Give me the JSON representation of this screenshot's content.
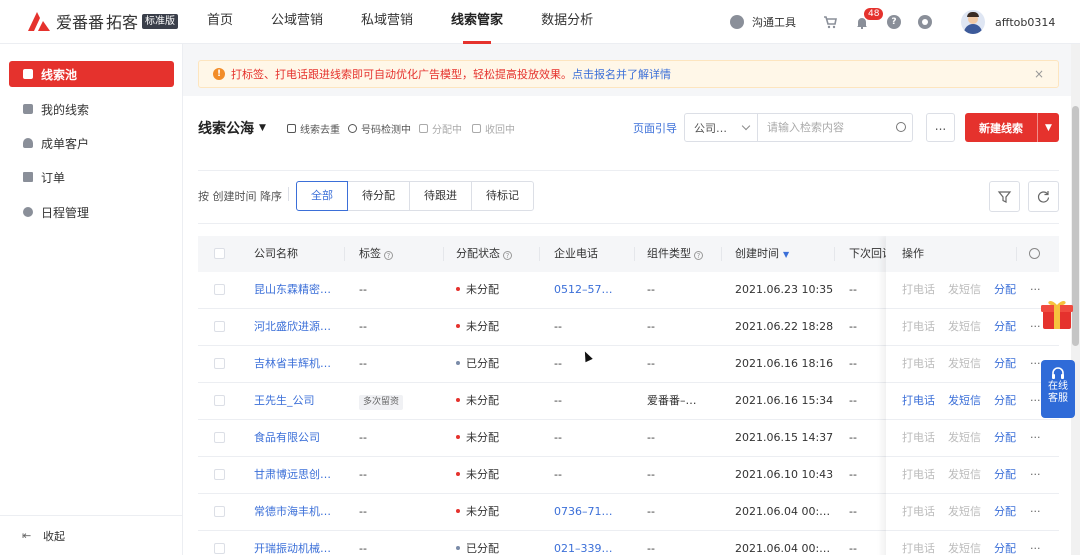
{
  "header": {
    "brand": "爱番番",
    "product": "拓客",
    "edition_badge": "标准版",
    "nav": [
      "首页",
      "公域营销",
      "私域营销",
      "线索管家",
      "数据分析"
    ],
    "active_nav": "线索管家",
    "comm_tool": "沟通工具",
    "notifications": "48",
    "username": "afftob0314"
  },
  "sidebar": {
    "items": [
      "线索池",
      "我的线索",
      "成单客户",
      "订单",
      "日程管理"
    ],
    "active": "线索池",
    "collapse_label": "收起"
  },
  "notice": {
    "text": "打标签、打电话跟进线索即可自动优化广告模型，轻松提高投放效果。",
    "link": "点击报名并了解详情",
    "close": "×"
  },
  "toolbar": {
    "title": "线索公海",
    "tools": [
      "线索去重",
      "号码检测中",
      "分配中",
      "收回中"
    ],
    "guide": "页面引导",
    "search_type": "公司…",
    "search_placeholder": "请输入检索内容",
    "more": "...",
    "new_lead": "新建线索"
  },
  "filters": {
    "sort_label": "按 创建时间 降序",
    "tabs": [
      "全部",
      "待分配",
      "待跟进",
      "待标记"
    ],
    "active": "全部"
  },
  "table": {
    "columns": [
      "公司名称",
      "标签",
      "分配状态",
      "企业电话",
      "组件类型",
      "创建时间",
      "下次回访",
      "操作"
    ],
    "actions": [
      "打电话",
      "发短信",
      "分配",
      "···"
    ],
    "rows": [
      {
        "company": "昆山东霖精密…",
        "tag": "--",
        "status": "未分配",
        "status_color": "#e5322d",
        "phone": "0512–57…",
        "component": "--",
        "created": "2021.06.23 10:35",
        "next": "--",
        "active": false
      },
      {
        "company": "河北盛欣进源…",
        "tag": "--",
        "status": "未分配",
        "status_color": "#e5322d",
        "phone": "--",
        "component": "--",
        "created": "2021.06.22 18:28",
        "next": "--",
        "active": false
      },
      {
        "company": "吉林省丰辉机…",
        "tag": "--",
        "status": "已分配",
        "status_color": "#7a8ba8",
        "phone": "--",
        "component": "--",
        "created": "2021.06.16 18:16",
        "next": "--",
        "active": false
      },
      {
        "company": "王先生_公司",
        "tag": "多次留资",
        "status": "未分配",
        "status_color": "#e5322d",
        "phone": "--",
        "component": "爱番番–…",
        "created": "2021.06.16 15:34",
        "next": "--",
        "active": true
      },
      {
        "company": "食品有限公司",
        "tag": "--",
        "status": "未分配",
        "status_color": "#e5322d",
        "phone": "--",
        "component": "--",
        "created": "2021.06.15 14:37",
        "next": "--",
        "active": false
      },
      {
        "company": "甘肃博远思创…",
        "tag": "--",
        "status": "未分配",
        "status_color": "#e5322d",
        "phone": "--",
        "component": "--",
        "created": "2021.06.10 10:43",
        "next": "--",
        "active": false
      },
      {
        "company": "常德市海丰机…",
        "tag": "--",
        "status": "未分配",
        "status_color": "#e5322d",
        "phone": "0736–71…",
        "component": "--",
        "created": "2021.06.04 00:…",
        "next": "--",
        "active": false
      },
      {
        "company": "开瑞振动机械…",
        "tag": "--",
        "status": "已分配",
        "status_color": "#7a8ba8",
        "phone": "021–339…",
        "component": "--",
        "created": "2021.06.04 00:…",
        "next": "--",
        "active": false
      }
    ]
  },
  "float": {
    "service_line1": "在线",
    "service_line2": "客服"
  }
}
